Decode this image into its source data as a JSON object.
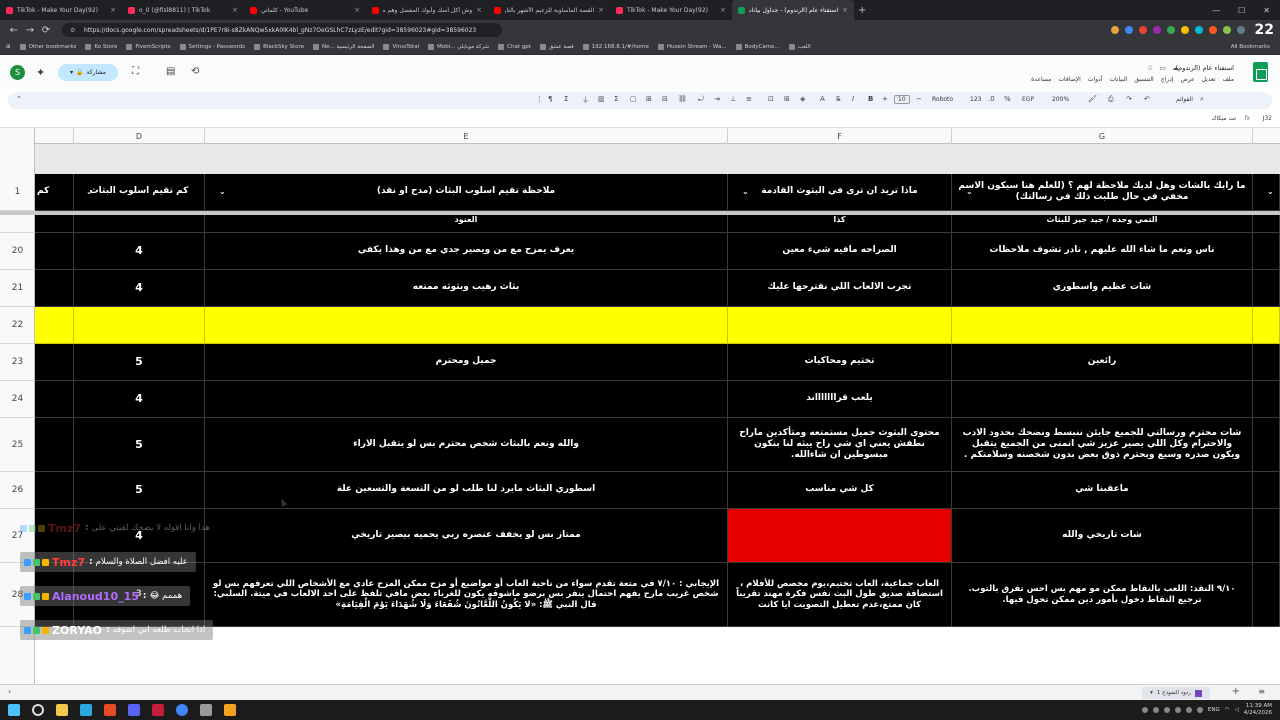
{
  "browser": {
    "tabs": [
      {
        "label": "(92)TikTok - Make Your Day",
        "color": "#fe2c55",
        "active": false
      },
      {
        "label": "o_0 (@fisl8811) | TikTok",
        "color": "#fe2c55",
        "active": false
      },
      {
        "label": "YouTube - كلماتي",
        "color": "#ff0000",
        "active": false
      },
      {
        "label": "وش أكل أسك وأبوك المفضل وهم صغار",
        "color": "#ff0000",
        "active": false
      },
      {
        "label": "القصة المأساوية للزعيم الأشهر بالتاريخ",
        "color": "#ff0000",
        "active": false
      },
      {
        "label": "(92)TikTok - Make Your Day",
        "color": "#fe2c55",
        "active": false
      },
      {
        "label": "استفتاء عام (الرندوم) - جداول بيانات",
        "color": "#0f9d58",
        "active": true
      }
    ],
    "url": "https://docs.google.com/spreadsheets/d/1PE7r8i-s8ZkANQw5xkA0lK4bl_gNz7OeGSLhC7zLyzE/edit?gid=38596023#gid=38596023",
    "profile_badge": "22",
    "bookmarks": [
      "Other bookmarks",
      "Ko Store",
      "FivemScripts",
      "Settings - Passwords",
      "BlackSky Store",
      "Ne... الصفحة الرئيسية",
      "VirusTotal",
      "Mobi... شركة موبايلي",
      "Chat gpt",
      "قصة عشق",
      "192.168.8.1/#/home",
      "Husein Stream - Wa...",
      "BodyCame...",
      "اللعب"
    ],
    "all_bookmarks": "All Bookmarks"
  },
  "sheets": {
    "doc_title": "استفتاء عام (الرندوم)",
    "menu": [
      "ملف",
      "تعديل",
      "عرض",
      "إدراج",
      "التنسيق",
      "البيانات",
      "أدوات",
      "الإضافات",
      "مساعدة"
    ],
    "share_label": "مشاركة",
    "avatar_letter": "S",
    "toolbar": {
      "zoom": "200%",
      "currency": "EGP",
      "font_name": "Roboto",
      "font_size": "10",
      "menus_label": "القوائم",
      "number_format": "123"
    },
    "formula_bar": {
      "cell_ref": "J32",
      "formula": "تت ميكاك"
    },
    "bottom": {
      "sheet_tab": "ردود النموذج 1",
      "add_sheet": "+"
    }
  },
  "grid": {
    "columns": [
      {
        "letter": "D"
      },
      {
        "letter": "E"
      },
      {
        "letter": "F"
      },
      {
        "letter": "G"
      }
    ],
    "header_row": {
      "row_num": "1",
      "prev_col_fragment": "كم",
      "D": "كم تقيم اسلوب البثاث",
      "E": "ملاحظة تقيم اسلوب البثاث (مدح او نقد)",
      "F": "ماذا تريد ان ترى في البثوث القادمة",
      "G": "ما رايك بالشات وهل لديك ملاحظة لهم ؟ (للعلم هنا سيكون الاسم مخفي في حال طلبت ذلك في رسالتك)"
    },
    "partial_row": {
      "E": "العنود",
      "F": "كذا",
      "G": "التمي وحده / جيد جير للبثاث"
    },
    "rows": [
      {
        "num": "20",
        "D": "4",
        "E": "يعرف يمزح مع من ويصير جدي مع من وهذا يكفي",
        "F": "الصراحه مافيه شيء معين",
        "G": "ناس ونعم ما شاء الله عليهم , نادر تشوف ملاحظات",
        "style": "normal"
      },
      {
        "num": "21",
        "D": "4",
        "E": "بثاث رهيب وبثوثه ممتعه",
        "F": "تجرب الالعاب اللي نقترحها عليك",
        "G": "شات عظيم واسطوري",
        "style": "normal"
      },
      {
        "num": "22",
        "D": "",
        "E": "",
        "F": "",
        "G": "",
        "style": "yellow"
      },
      {
        "num": "23",
        "D": "5",
        "E": "جميل ومحترم",
        "F": "تختيم ومحاكيات",
        "G": "رائعين",
        "style": "normal"
      },
      {
        "num": "24",
        "D": "4",
        "E": "",
        "F": "يلعب قراااااااند",
        "G": "",
        "style": "normal"
      },
      {
        "num": "25",
        "D": "5",
        "E": "والله ونعم بالبثاث شخص محترم بس لو يتقبل الاراء",
        "F": "محتوى البثوث جميل مستمتعه ومتأكدين ماراح نطفش يعني اي شي راح يبثه لنا بنكون مبسوطين ان شاءالله.",
        "G": "شات محترم ورسالتي للجميع جايئن ننبسط ونضحك بحدود الادب والاحترام وكل اللي يصير عزيز شي اتمنى من الجميع يتقبل ويكون صدره وسيع ويحترم ذوق بعض بدون شخصنه وسلامتكم .",
        "style": "normal"
      },
      {
        "num": "26",
        "D": "5",
        "E": "اسطوري البثاث مايرد لنا طلب لو من التسعة والتسعين علة",
        "F": "كل شي مناسب",
        "G": "ماعقبنا شي",
        "style": "normal"
      },
      {
        "num": "27",
        "D": "4",
        "E": "ممتاز بس لو يخفف عنصره ربي يحميه بيصير تاريخي",
        "F": "",
        "G": "شات تاريخي والله",
        "style": "redF"
      },
      {
        "num": "28",
        "D": "3",
        "E": "الإيجابي : ٧/١٠ في متعة تقدم سواء من ناحية العاب أو مواضيع أو مزح ممكن المزح عادي مع الأشخاص اللي تعرفهم بس لو شخص غريب مارح يفهم احتمال ينفر بس برضو ماشوفه يكون للغرباء بعض مافي تلفظ على احد الالعاب في ميتة. السلبي: قال النبي ﷺ: «لا يَكُونُ اللَّعَّانُونَ شُفَعَاءَ وَلَا شُهَدَاءَ يَوْمَ الْقِيَامَةِ»",
        "F": "العاب جماعية، العاب تختيم،يوم مخصص للأفلام ، استضافة صديق طول البث نفس فكرة مهند تقريباً كان ممتع،عدم تعطيل التصويت ايا كانت",
        "G": "٩/١٠ النقد: اللعب بالنقاط ممكن مو مهم بس احس تفرق بالتوب. ترجيع النقاط دخول بأمور دين ممكن تحول فيها.",
        "style": "tall"
      }
    ]
  },
  "chat": [
    {
      "user": "Tmz7",
      "message": "هذا وانا اقوله لا يضحك لقيتي على",
      "user_color": "#ff3b3b",
      "dim": true
    },
    {
      "user": "Tmz7",
      "message": "عليه افضل الصلاة والسلام",
      "user_color": "#ff3b3b",
      "dim": false
    },
    {
      "user": "Alanoud10_15",
      "message": "هممم 😂",
      "user_color": "#b06cff",
      "dim": false
    },
    {
      "user": "ZORYAO",
      "message": "اذا انجاب طلعه ابي اشوفه",
      "user_color": "#ffffff",
      "dim": false
    }
  ],
  "taskbar": {
    "time": "11:39 AM",
    "date": "4/24/2026",
    "lang": "ENG"
  }
}
